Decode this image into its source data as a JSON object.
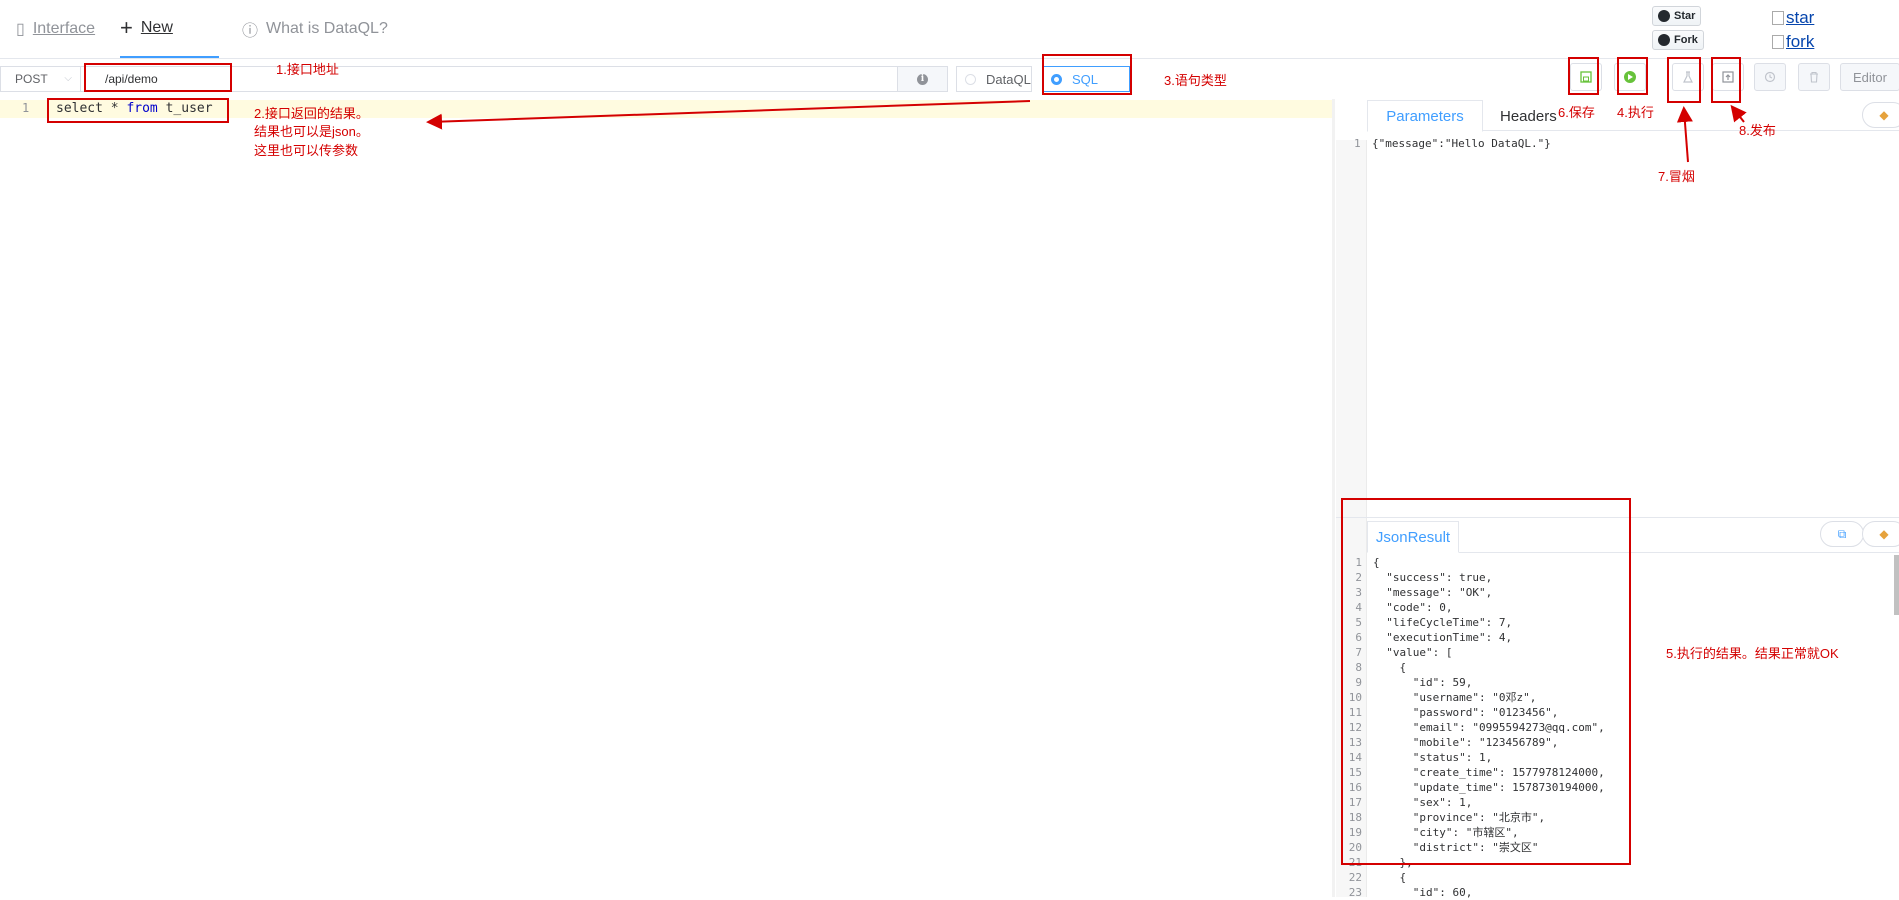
{
  "nav": {
    "tabs": [
      {
        "label": "Interface",
        "icon": "book-icon"
      },
      {
        "label": "New",
        "icon": "plus-icon"
      },
      {
        "label": "What is DataQL?",
        "icon": "info-circle-icon"
      }
    ],
    "github": {
      "star_label": "Star",
      "fork_label": "Fork"
    },
    "badges": {
      "star": "star",
      "fork": "fork"
    }
  },
  "toolbar": {
    "method": "POST",
    "url": "/api/demo",
    "radio_options": [
      {
        "label": "DataQL",
        "selected": false
      },
      {
        "label": "SQL",
        "selected": true
      }
    ],
    "editor_label": "Editor",
    "accent_color": "#409eff",
    "run_color": "#67c23a"
  },
  "editor": {
    "line_number": "1",
    "code_prefix": "select * ",
    "code_keyword": "from",
    "code_suffix": " t_user"
  },
  "parameters": {
    "tabs": [
      "Parameters",
      "Headers"
    ],
    "line_number": "1",
    "content": "{\"message\":\"Hello DataQL.\"}"
  },
  "result": {
    "tab": "JsonResult",
    "line_numbers": [
      "1",
      "2",
      "3",
      "4",
      "5",
      "6",
      "7",
      "8",
      "9",
      "10",
      "11",
      "12",
      "13",
      "14",
      "15",
      "16",
      "17",
      "18",
      "19",
      "20",
      "21",
      "22",
      "23"
    ],
    "lines": [
      "{",
      "  \"success\": true,",
      "  \"message\": \"OK\",",
      "  \"code\": 0,",
      "  \"lifeCycleTime\": 7,",
      "  \"executionTime\": 4,",
      "  \"value\": [",
      "    {",
      "      \"id\": 59,",
      "      \"username\": \"0邓z\",",
      "      \"password\": \"0123456\",",
      "      \"email\": \"0995594273@qq.com\",",
      "      \"mobile\": \"123456789\",",
      "      \"status\": 1,",
      "      \"create_time\": 1577978124000,",
      "      \"update_time\": 1578730194000,",
      "      \"sex\": 1,",
      "      \"province\": \"北京市\",",
      "      \"city\": \"市辖区\",",
      "      \"district\": \"崇文区\"",
      "    },",
      "    {",
      "      \"id\": 60,"
    ]
  },
  "annotations": {
    "url": "1.接口地址",
    "result_line1": "2.接口返回的结果。",
    "result_line2": "结果也可以是json。",
    "result_line3": "这里也可以传参数",
    "type": "3.语句类型",
    "run": "4.执行",
    "exec_result": "5.执行的结果。结果正常就OK",
    "save": "6.保存",
    "smoke": "7.冒烟",
    "publish": "8.发布",
    "color": "#d40000"
  }
}
